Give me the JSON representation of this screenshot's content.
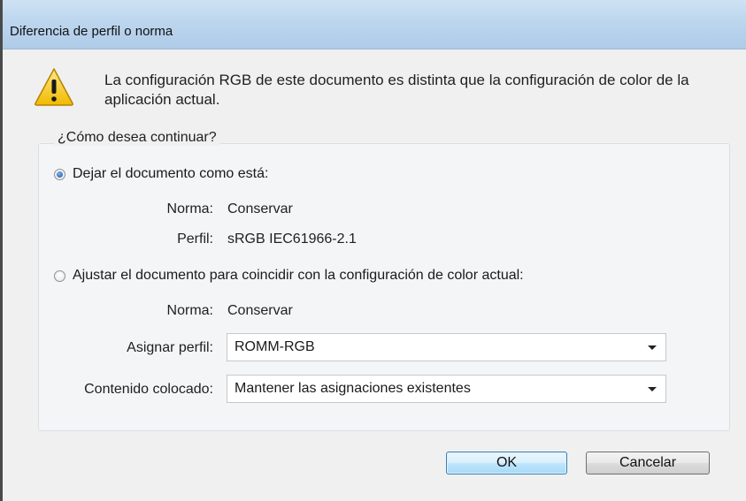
{
  "dialog": {
    "title": "Diferencia de perfil o norma",
    "message": "La configuración RGB de este documento es distinta que la configuración de color de la aplicación actual.",
    "icon": "warning-icon"
  },
  "group": {
    "legend": "¿Cómo desea continuar?",
    "option_keep": {
      "label": "Dejar el documento como está:",
      "checked": true,
      "policy_label": "Norma:",
      "policy_value": "Conservar",
      "profile_label": "Perfil:",
      "profile_value": "sRGB IEC61966-2.1"
    },
    "option_adjust": {
      "label": "Ajustar el documento para coincidir con la configuración de color actual:",
      "checked": false,
      "policy_label": "Norma:",
      "policy_value": "Conservar",
      "assign_profile_label": "Asignar perfil:",
      "assign_profile_value": "ROMM-RGB",
      "placed_content_label": "Contenido colocado:",
      "placed_content_value": "Mantener las asignaciones existentes"
    }
  },
  "buttons": {
    "ok": "OK",
    "cancel": "Cancelar"
  },
  "colors": {
    "titlebar": "#bcd6ee",
    "default_button_border": "#3c7fb1",
    "radio_selected": "#2d6fc1"
  }
}
